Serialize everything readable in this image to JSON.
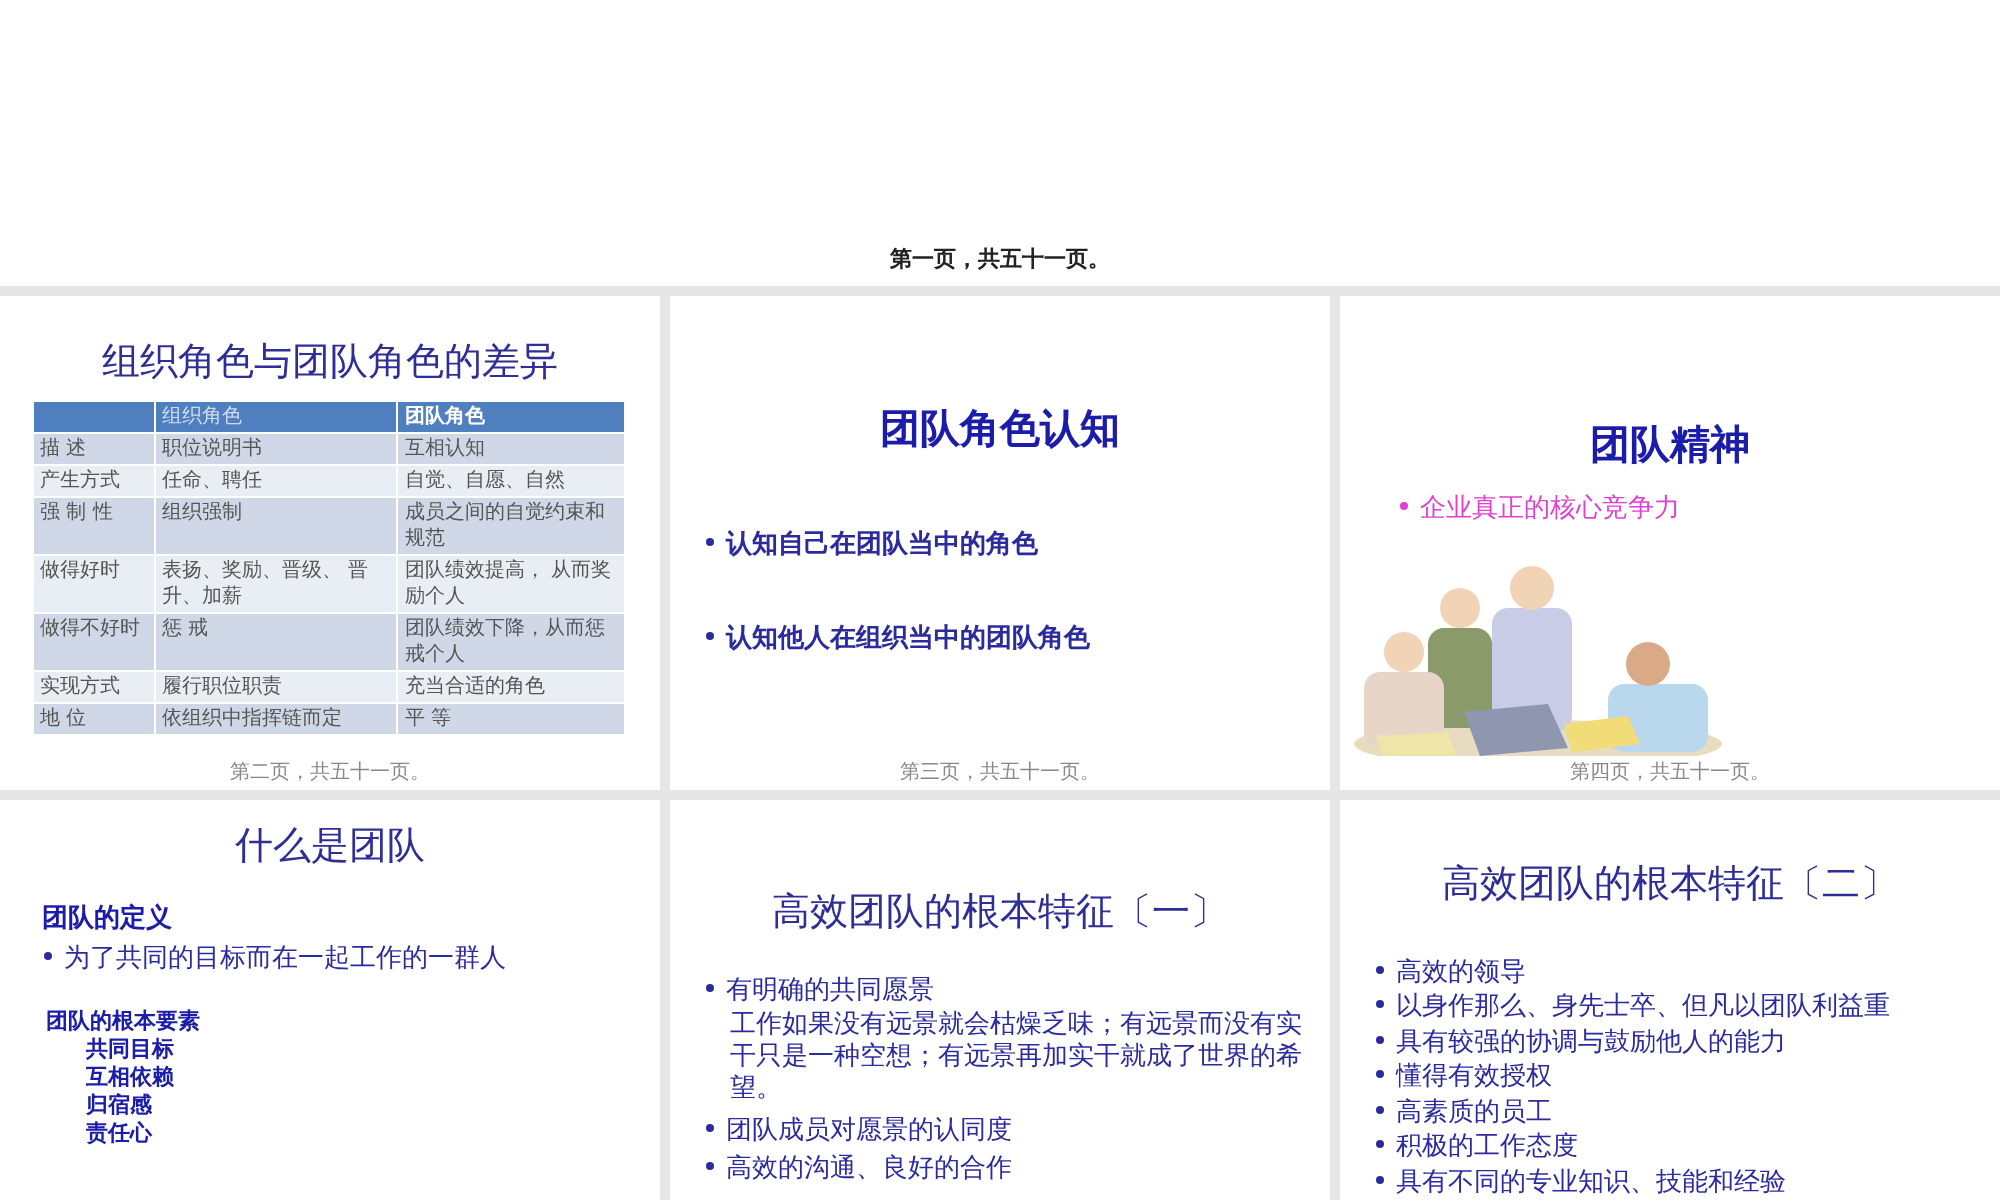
{
  "header": {
    "page_label": "第一页，共五十一页。"
  },
  "slides": [
    {
      "kind": "table",
      "title": "组织角色与团队角色的差异",
      "columns": [
        "组织角色",
        "团队角色"
      ],
      "rows": [
        {
          "label": "描 述",
          "cells": [
            "职位说明书",
            "互相认知"
          ]
        },
        {
          "label": "产生方式",
          "cells": [
            "任命、聘任",
            "自觉、自愿、自然"
          ]
        },
        {
          "label": "强 制 性",
          "cells": [
            "组织强制",
            "成员之间的自觉约束和规范"
          ]
        },
        {
          "label": "做得好时",
          "cells": [
            "表扬、奖励、晋级、 晋升、加薪",
            "团队绩效提高， 从而奖励个人"
          ]
        },
        {
          "label": "做得不好时",
          "cells": [
            "惩 戒",
            "团队绩效下降，从而惩戒个人"
          ]
        },
        {
          "label": "实现方式",
          "cells": [
            "履行职位职责",
            "充当合适的角色"
          ]
        },
        {
          "label": "地 位",
          "cells": [
            "依组织中指挥链而定",
            "平 等"
          ]
        }
      ],
      "footer": "第二页，共五十一页。"
    },
    {
      "kind": "bullets",
      "title": "团队角色认知",
      "bullets": [
        "认知自己在团队当中的角色",
        "认知他人在组织当中的团队角色"
      ],
      "footer": "第三页，共五十一页。"
    },
    {
      "kind": "picture",
      "title": "团队精神",
      "bullets": [
        "企业真正的核心竞争力"
      ],
      "footer": "第四页，共五十一页。"
    },
    {
      "kind": "definition",
      "title": "什么是团队",
      "heading": "团队的定义",
      "bullets": [
        "为了共同的目标而在一起工作的一群人"
      ],
      "subheading": "团队的根本要素",
      "elements": [
        "共同目标",
        "互相依赖",
        "归宿感",
        "责任心"
      ]
    },
    {
      "kind": "features",
      "title": "高效团队的根本特征〔一〕",
      "items": [
        {
          "kind": "bullet",
          "text": "有明确的共同愿景"
        },
        {
          "kind": "paragraph",
          "text": "工作如果没有远景就会枯燥乏味；有远景而没有实干只是一种空想；有远景再加实干就成了世界的希望。"
        },
        {
          "kind": "bullet",
          "text": "团队成员对愿景的认同度"
        },
        {
          "kind": "bullet",
          "text": "高效的沟通、良好的合作"
        }
      ]
    },
    {
      "kind": "features",
      "title": "高效团队的根本特征〔二〕",
      "items": [
        {
          "kind": "bullet",
          "text": "高效的领导"
        },
        {
          "kind": "bullet",
          "text": "以身作那么、身先士卒、但凡以团队利益重"
        },
        {
          "kind": "bullet",
          "text": "具有较强的协调与鼓励他人的能力"
        },
        {
          "kind": "bullet",
          "text": "懂得有效授权"
        },
        {
          "kind": "bullet",
          "text": "高素质的员工"
        },
        {
          "kind": "bullet",
          "text": "积极的工作态度"
        },
        {
          "kind": "bullet",
          "text": "具有不同的专业知识、技能和经验"
        }
      ]
    }
  ]
}
